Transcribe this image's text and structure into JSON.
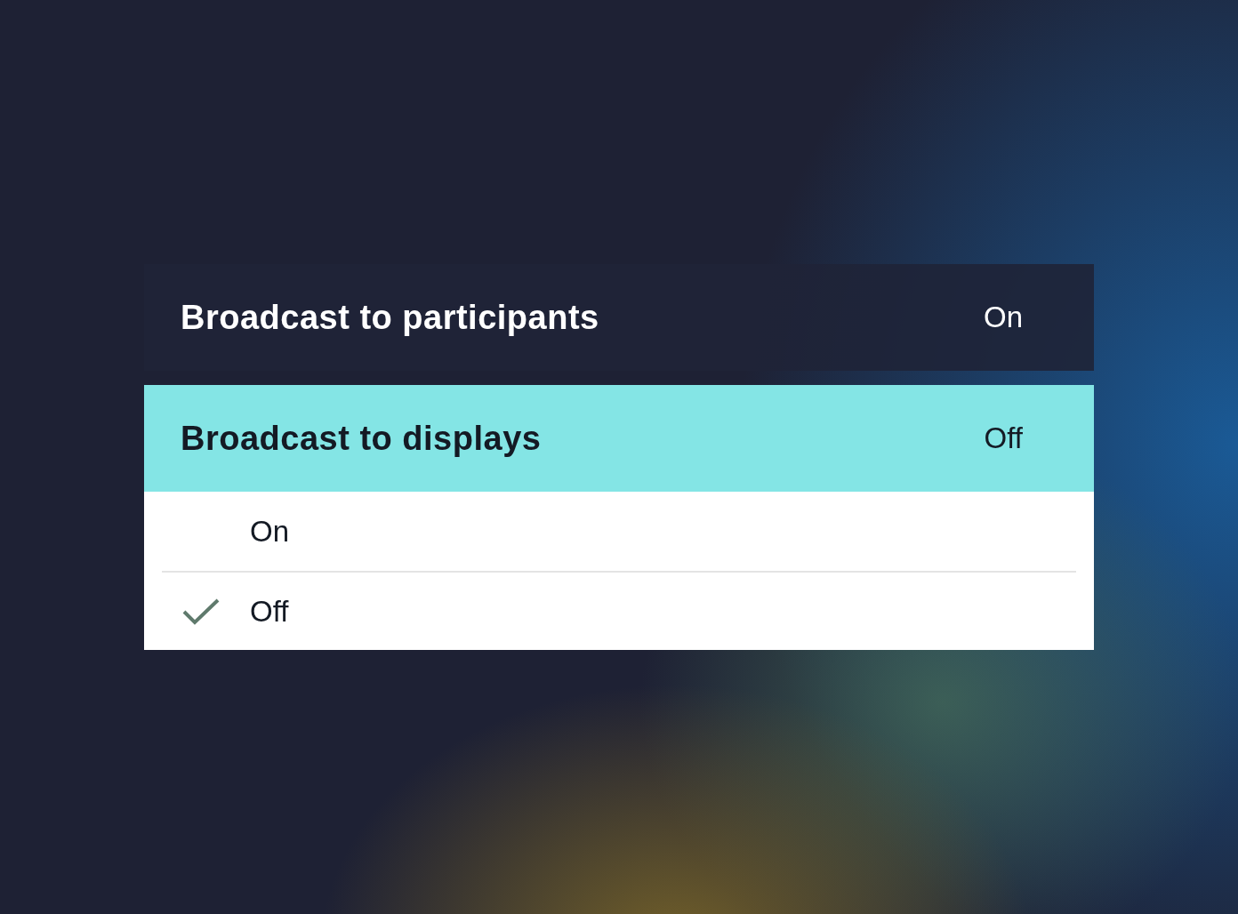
{
  "settings": [
    {
      "label": "Broadcast to participants",
      "value": "On",
      "selected": false
    },
    {
      "label": "Broadcast to displays",
      "value": "Off",
      "selected": true,
      "expanded": true,
      "options": [
        {
          "label": "On",
          "selected": false
        },
        {
          "label": "Off",
          "selected": true
        }
      ]
    }
  ]
}
